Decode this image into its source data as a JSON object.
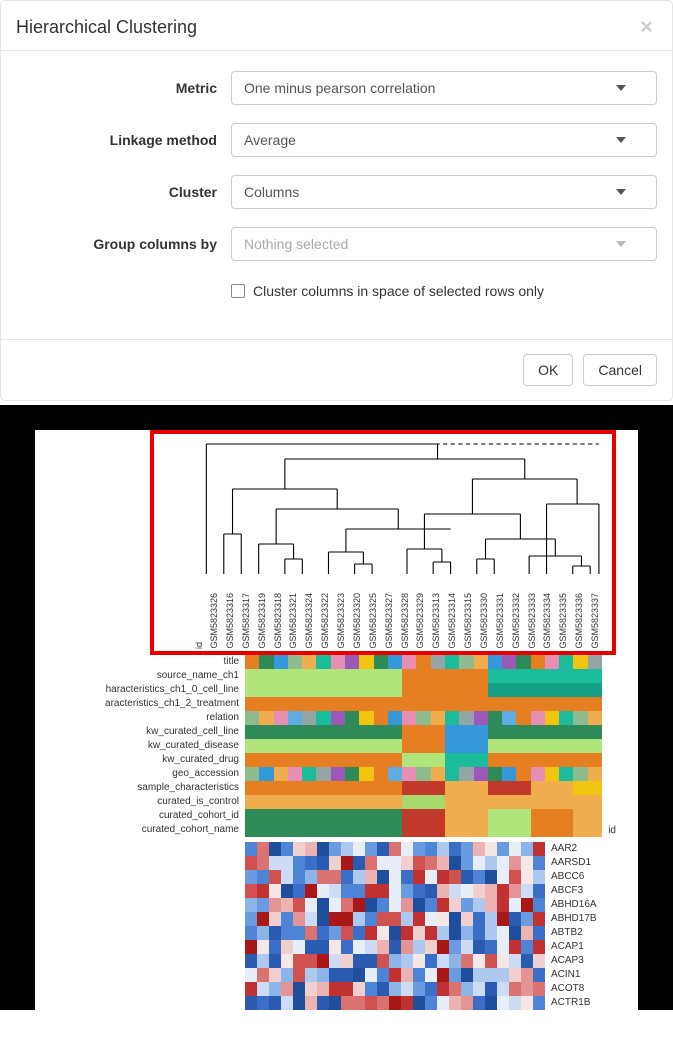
{
  "dialog": {
    "title": "Hierarchical Clustering",
    "close": "×",
    "fields": {
      "metric": {
        "label": "Metric",
        "value": "One minus pearson correlation"
      },
      "linkage": {
        "label": "Linkage method",
        "value": "Average"
      },
      "cluster": {
        "label": "Cluster",
        "value": "Columns"
      },
      "group_by": {
        "label": "Group columns by",
        "placeholder": "Nothing selected"
      }
    },
    "checkbox": {
      "label": "Cluster columns in space of selected rows only",
      "checked": false
    },
    "buttons": {
      "ok": "OK",
      "cancel": "Cancel"
    }
  },
  "figure": {
    "id_label": "id",
    "columns": [
      "GSM5823326",
      "GSM5823316",
      "GSM5823317",
      "GSM5823319",
      "GSM5823318",
      "GSM5823321",
      "GSM5823324",
      "GSM5823322",
      "GSM5823323",
      "GSM5823320",
      "GSM5823325",
      "GSM5823327",
      "GSM5823328",
      "GSM5823329",
      "GSM5823313",
      "GSM5823314",
      "GSM5823315",
      "GSM5823330",
      "GSM5823331",
      "GSM5823332",
      "GSM5823333",
      "GSM5823334",
      "GSM5823335",
      "GSM5823336",
      "GSM5823337"
    ],
    "annotation_rows": [
      "title",
      "source_name_ch1",
      "haracteristics_ch1_0_cell_line",
      "aracteristics_ch1_2_treatment",
      "relation",
      "kw_curated_cell_line",
      "kw_curated_disease",
      "kw_curated_drug",
      "geo_accession",
      "sample_characteristics",
      "curated_is_control",
      "curated_cohort_id",
      "curated_cohort_name"
    ],
    "annotation_colors": [
      [
        "or2",
        "g1",
        "bl1",
        "g2",
        "or3",
        "tl",
        "pk",
        "pu",
        "yl",
        "g1",
        "bl1",
        "pk",
        "or2",
        "gr",
        "tl",
        "g2",
        "or3",
        "bl1",
        "pu",
        "g1",
        "or2",
        "pk",
        "tl",
        "yl",
        "gr"
      ],
      [
        "g3",
        "g3",
        "g3",
        "g3",
        "g3",
        "g3",
        "g3",
        "g3",
        "g3",
        "g3",
        "g3",
        "or2",
        "or2",
        "or2",
        "or2",
        "or2",
        "or2",
        "tl",
        "tl",
        "tl",
        "tl",
        "tl",
        "tl",
        "tl",
        "tl"
      ],
      [
        "g3",
        "g3",
        "g3",
        "g3",
        "g3",
        "g3",
        "g3",
        "g3",
        "g3",
        "g3",
        "g3",
        "or2",
        "or2",
        "or2",
        "or2",
        "or2",
        "or2",
        "dg",
        "dg",
        "dg",
        "dg",
        "dg",
        "dg",
        "dg",
        "dg"
      ],
      [
        "or2",
        "or2",
        "or2",
        "or2",
        "or2",
        "or2",
        "or2",
        "or2",
        "or2",
        "or2",
        "or2",
        "or2",
        "or2",
        "or2",
        "or2",
        "or2",
        "or2",
        "or2",
        "or2",
        "or2",
        "or2",
        "or2",
        "or2",
        "or2",
        "or2"
      ],
      [
        "g2",
        "or3",
        "pk",
        "bl2",
        "gr",
        "tl",
        "pu",
        "g1",
        "yl",
        "or2",
        "bl1",
        "pk",
        "g2",
        "or3",
        "tl",
        "gr",
        "pu",
        "g1",
        "bl2",
        "or2",
        "pk",
        "yl",
        "tl",
        "g2",
        "or3"
      ],
      [
        "g1",
        "g1",
        "g1",
        "g1",
        "g1",
        "g1",
        "g1",
        "g1",
        "g1",
        "g1",
        "g1",
        "or2",
        "or2",
        "or2",
        "bl1",
        "bl1",
        "bl1",
        "g1",
        "g1",
        "g1",
        "g1",
        "g1",
        "g1",
        "g1",
        "g1"
      ],
      [
        "g3",
        "g3",
        "g3",
        "g3",
        "g3",
        "g3",
        "g3",
        "g3",
        "g3",
        "g3",
        "g3",
        "or2",
        "or2",
        "or2",
        "bl1",
        "bl1",
        "bl1",
        "g3",
        "g3",
        "g3",
        "g3",
        "g3",
        "g3",
        "g3",
        "g3"
      ],
      [
        "or2",
        "or2",
        "or2",
        "or2",
        "or2",
        "or2",
        "or2",
        "or2",
        "or2",
        "or2",
        "or2",
        "g3",
        "g3",
        "g3",
        "tl",
        "tl",
        "tl",
        "or2",
        "or2",
        "or2",
        "or2",
        "or2",
        "or2",
        "or2",
        "or2"
      ],
      [
        "g2",
        "bl1",
        "or3",
        "pk",
        "tl",
        "gr",
        "pu",
        "g1",
        "yl",
        "or2",
        "bl2",
        "pk",
        "g2",
        "or3",
        "tl",
        "gr",
        "pu",
        "g1",
        "bl1",
        "or2",
        "pk",
        "yl",
        "tl",
        "g2",
        "or3"
      ],
      [
        "or2",
        "or2",
        "or2",
        "or2",
        "or2",
        "or2",
        "or2",
        "or2",
        "or2",
        "or2",
        "or2",
        "rd",
        "rd",
        "rd",
        "or3",
        "or3",
        "or3",
        "rd",
        "rd",
        "rd",
        "or3",
        "or3",
        "or3",
        "yl",
        "yl"
      ],
      [
        "or3",
        "or3",
        "or3",
        "or3",
        "or3",
        "or3",
        "or3",
        "or3",
        "or3",
        "or3",
        "or3",
        "g4",
        "g4",
        "g4",
        "or3",
        "or3",
        "or3",
        "or3",
        "or3",
        "or3",
        "or3",
        "or3",
        "or3",
        "or3",
        "or3"
      ],
      [
        "g1",
        "g1",
        "g1",
        "g1",
        "g1",
        "g1",
        "g1",
        "g1",
        "g1",
        "g1",
        "g1",
        "rd",
        "rd",
        "rd",
        "or3",
        "or3",
        "or3",
        "g3",
        "g3",
        "g3",
        "or2",
        "or2",
        "or2",
        "or3",
        "or3"
      ],
      [
        "g1",
        "g1",
        "g1",
        "g1",
        "g1",
        "g1",
        "g1",
        "g1",
        "g1",
        "g1",
        "g1",
        "rd",
        "rd",
        "rd",
        "or3",
        "or3",
        "or3",
        "g3",
        "g3",
        "g3",
        "or2",
        "or2",
        "or2",
        "or3",
        "or3"
      ]
    ],
    "id_right": "id",
    "genes": [
      "AAR2",
      "AARSD1",
      "ABCC6",
      "ABCF3",
      "ABHD16A",
      "ABHD17B",
      "ABTB2",
      "ACAP1",
      "ACAP3",
      "ACIN1",
      "ACOT8",
      "ACTR1B"
    ],
    "heat_colors": [
      "#1f4e9c",
      "#2b5bb0",
      "#3a6ec7",
      "#4e84d6",
      "#6a9be0",
      "#8cb4e9",
      "#adc9ef",
      "#cddcf4",
      "#e8eef8",
      "#f6e7e7",
      "#f2cfcf",
      "#ecb3b2",
      "#e49494",
      "#da7272",
      "#cf5150",
      "#c03131",
      "#a91717"
    ]
  }
}
